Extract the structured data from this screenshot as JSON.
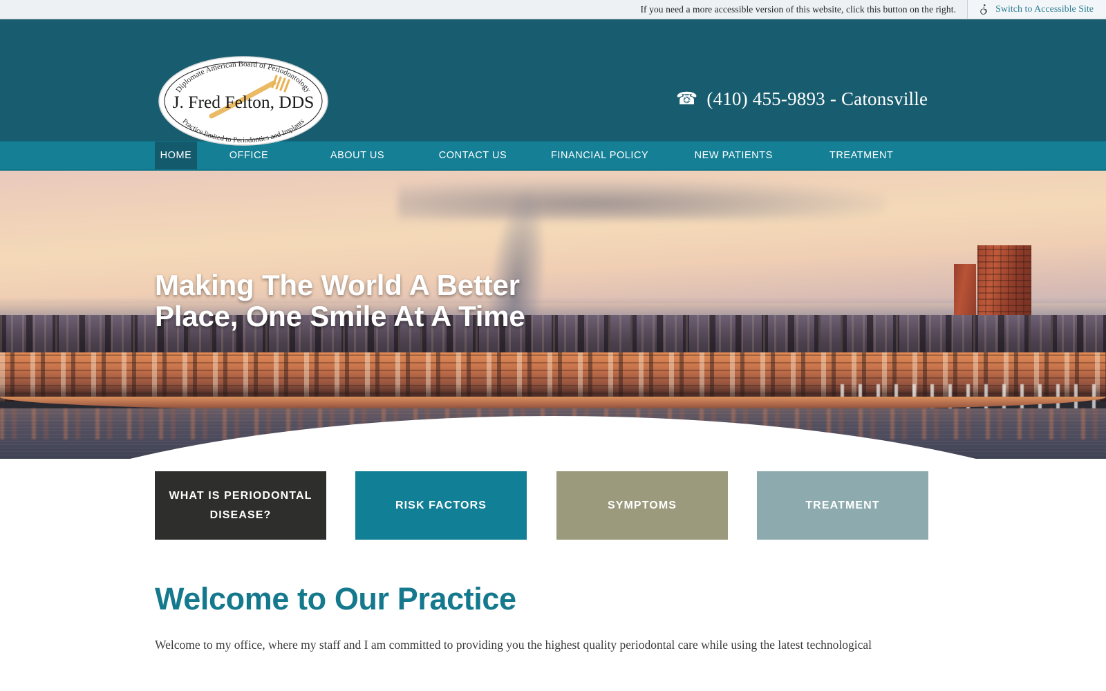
{
  "accessibility_bar": {
    "message": "If you need a more accessible version of this website, click this button on the right.",
    "button_label": "Switch to Accessible Site",
    "icon": "wheelchair-accessible-icon"
  },
  "header": {
    "logo": {
      "top_arc_text": "Diplomate American Board of Periodontology",
      "center_text": "J. Fred Felton, DDS",
      "bottom_arc_text": "Practice limited to Periodontics and Implants",
      "icon": "toothbrush-icon"
    },
    "phone": {
      "icon": "telephone-icon",
      "glyph": "☎",
      "text": "(410) 455-9893 - Catonsville"
    },
    "background_color": "#185d6f"
  },
  "nav": {
    "background_color": "#157f95",
    "active_color": "#125a6c",
    "items": [
      {
        "label": "HOME",
        "active": true
      },
      {
        "label": "OFFICE",
        "active": false
      },
      {
        "label": "ABOUT US",
        "active": false
      },
      {
        "label": "CONTACT US",
        "active": false
      },
      {
        "label": "FINANCIAL POLICY",
        "active": false
      },
      {
        "label": "NEW PATIENTS",
        "active": false
      },
      {
        "label": "TREATMENT",
        "active": false
      }
    ]
  },
  "hero": {
    "headline_line1": "Making The World A Better",
    "headline_line2": "Place, One Smile At A Time",
    "image_description": "Aerial sunset photo of a city harbor waterfront with reflections"
  },
  "cards": [
    {
      "label": "WHAT IS PERIODONTAL DISEASE?",
      "color": "#2e2e2d"
    },
    {
      "label": "RISK FACTORS",
      "color": "#117f95"
    },
    {
      "label": "SYMPTOMS",
      "color": "#9b9a7c"
    },
    {
      "label": "TREATMENT",
      "color": "#8dabaf"
    }
  ],
  "welcome": {
    "heading": "Welcome to Our Practice",
    "body": "Welcome to my office, where my staff and I am committed to providing you the highest quality periodontal care while using the latest technological"
  }
}
